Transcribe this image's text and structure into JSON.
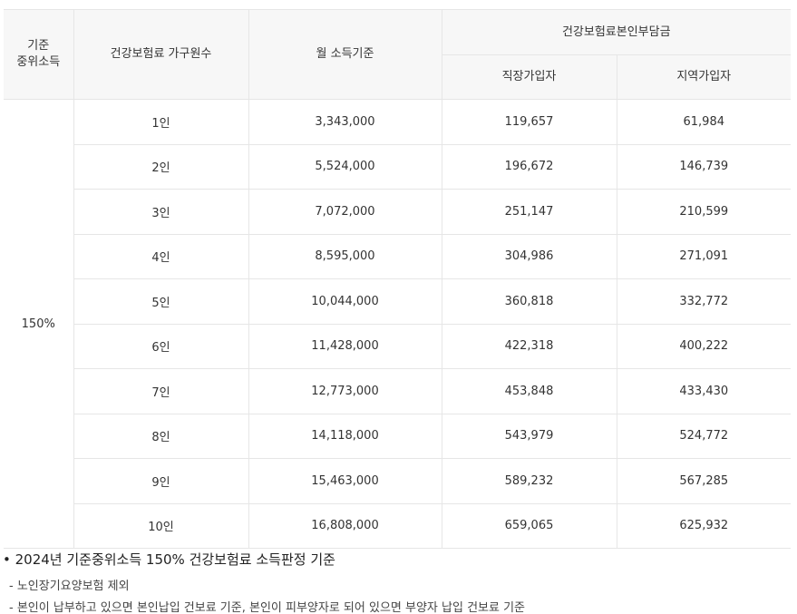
{
  "table": {
    "headers": {
      "median_income": "기준\n중위소득",
      "household_size": "건강보험료 가구원수",
      "monthly_income": "월 소득기준",
      "premium_group": "건강보험료본인부담금",
      "employee": "직장가입자",
      "regional": "지역가입자"
    },
    "ratio": "150%",
    "rows": [
      {
        "size": "1인",
        "income": "3,343,000",
        "employee": "119,657",
        "regional": "61,984"
      },
      {
        "size": "2인",
        "income": "5,524,000",
        "employee": "196,672",
        "regional": "146,739"
      },
      {
        "size": "3인",
        "income": "7,072,000",
        "employee": "251,147",
        "regional": "210,599"
      },
      {
        "size": "4인",
        "income": "8,595,000",
        "employee": "304,986",
        "regional": "271,091"
      },
      {
        "size": "5인",
        "income": "10,044,000",
        "employee": "360,818",
        "regional": "332,772"
      },
      {
        "size": "6인",
        "income": "11,428,000",
        "employee": "422,318",
        "regional": "400,222"
      },
      {
        "size": "7인",
        "income": "12,773,000",
        "employee": "453,848",
        "regional": "433,430"
      },
      {
        "size": "8인",
        "income": "14,118,000",
        "employee": "543,979",
        "regional": "524,772"
      },
      {
        "size": "9인",
        "income": "15,463,000",
        "employee": "589,232",
        "regional": "567,285"
      },
      {
        "size": "10인",
        "income": "16,808,000",
        "employee": "659,065",
        "regional": "625,932"
      }
    ]
  },
  "notes": {
    "main": "• 2024년 기준중위소득 150% 건강보험료 소득판정 기준",
    "sub1": "- 노인장기요양보험 제외",
    "sub2": "- 본인이 납부하고 있으면 본인납입 건보료 기준, 본인이 피부양자로 되어 있으면 부양자 납입 건보료 기준"
  }
}
